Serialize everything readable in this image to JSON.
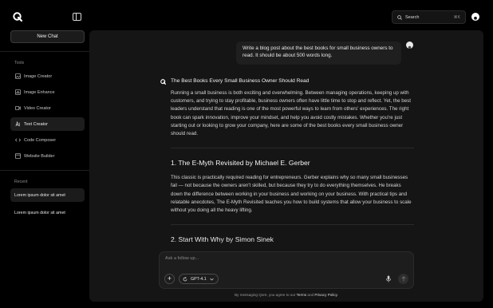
{
  "sidebar": {
    "new_chat_label": "New Chat",
    "tools_label": "Tools",
    "tools": [
      {
        "label": "Image Creator",
        "icon": "image-icon"
      },
      {
        "label": "Image Enhance",
        "icon": "image-enhance-icon"
      },
      {
        "label": "Video Creator",
        "icon": "video-icon"
      },
      {
        "label": "Text Creator",
        "icon": "text-icon",
        "active": true
      },
      {
        "label": "Code Composer",
        "icon": "code-icon"
      },
      {
        "label": "Website Builder",
        "icon": "website-icon"
      }
    ],
    "recent_label": "Recent",
    "recent": [
      {
        "label": "Lorem ipsum dolor sit amet",
        "active": true
      },
      {
        "label": "Lorem ipsum dolor sit amet"
      }
    ]
  },
  "header": {
    "search_label": "Search",
    "search_shortcut": "⌘K"
  },
  "chat": {
    "user_message": "Write a blog post about the best books for small business owners to read. It should be about 500 words long.",
    "answer_title": "The Best Books Every Small Business Owner Should Read",
    "answer_intro": "Running a small business is both exciting and overwhelming. Between managing operations, keeping up with customers, and trying to stay profitable, business owners often have little time to stop and reflect. Yet, the best leaders understand that reading is one of the most powerful ways to learn from others' experiences. The right book can spark innovation, improve your mindset, and help you avoid costly mistakes. Whether you're just starting out or looking to grow your company, here are some of the best books every small business owner should read.",
    "section1_title": "1. The E-Myth Revisited by Michael E. Gerber",
    "section1_body": "This classic is practically required reading for entrepreneurs. Gerber explains why so many small businesses fail — not because the owners aren't skilled, but because they try to do everything themselves. He breaks down the difference between working in your business and working on your business. With practical tips and relatable anecdotes, The E-Myth Revisited teaches you how to build systems that allow your business to scale without you doing all the heavy lifting.",
    "section2_title": "2. Start With Why by Simon Sinek"
  },
  "composer": {
    "placeholder": "Ask a follow up...",
    "model_label": "GPT-4.1"
  },
  "footer": {
    "prefix": "By messaging Qore, you agree to our ",
    "terms": "Terms",
    "and": " and ",
    "privacy": "Privacy Policy",
    "suffix": "."
  },
  "colors": {
    "background": "#000000",
    "panel": "#151515",
    "accent_text": "#e6e6e6"
  }
}
